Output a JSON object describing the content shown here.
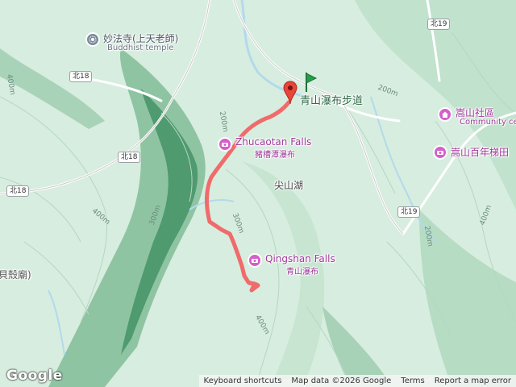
{
  "places": {
    "miaofa_temple_zh": "妙法寺(上天老師)",
    "miaofa_temple_en": "Buddhist temple",
    "trail_name": "青山瀑布步道",
    "community_center_zh": "嵩山社區",
    "community_center_en": "Community ce",
    "songshan_terrace_zh": "嵩山百年梯田",
    "zhucaotan_en": "Zhucaotan Falls",
    "zhucaotan_zh": "豬槽潭瀑布",
    "qingshan_en": "Qingshan Falls",
    "qingshan_zh": "青山瀑布",
    "jianshan_lake": "尖山湖",
    "left_temple_partial": "貝殼廟)"
  },
  "roads": {
    "bei18_a": "北18",
    "bei18_b": "北18",
    "bei18_c": "北18",
    "bei19_a": "北19",
    "bei19_b": "北19"
  },
  "contours": {
    "c200_a": "200m",
    "c200_b": "200m",
    "c300_a": "300m",
    "c300_b": "300m",
    "c400_a": "400m",
    "c400_b": "400m",
    "c400_c": "400m",
    "c400_d": "400m",
    "c200_c": "200m"
  },
  "footer": {
    "shortcuts": "Keyboard shortcuts",
    "map_data": "Map data ©2026 Google",
    "terms": "Terms",
    "report": "Report a map error"
  },
  "logo": "Google",
  "colors": {
    "route": "#f06b6b",
    "poi_pink": "#d460c9",
    "marker_red": "#e8463b",
    "start_flag": "#22a04a",
    "water": "#aadaff",
    "terrain_dark": "#3f8a60"
  },
  "icons": {
    "temple": "buddhist-temple-icon",
    "waterfall": "camera-icon",
    "community": "home-icon"
  }
}
